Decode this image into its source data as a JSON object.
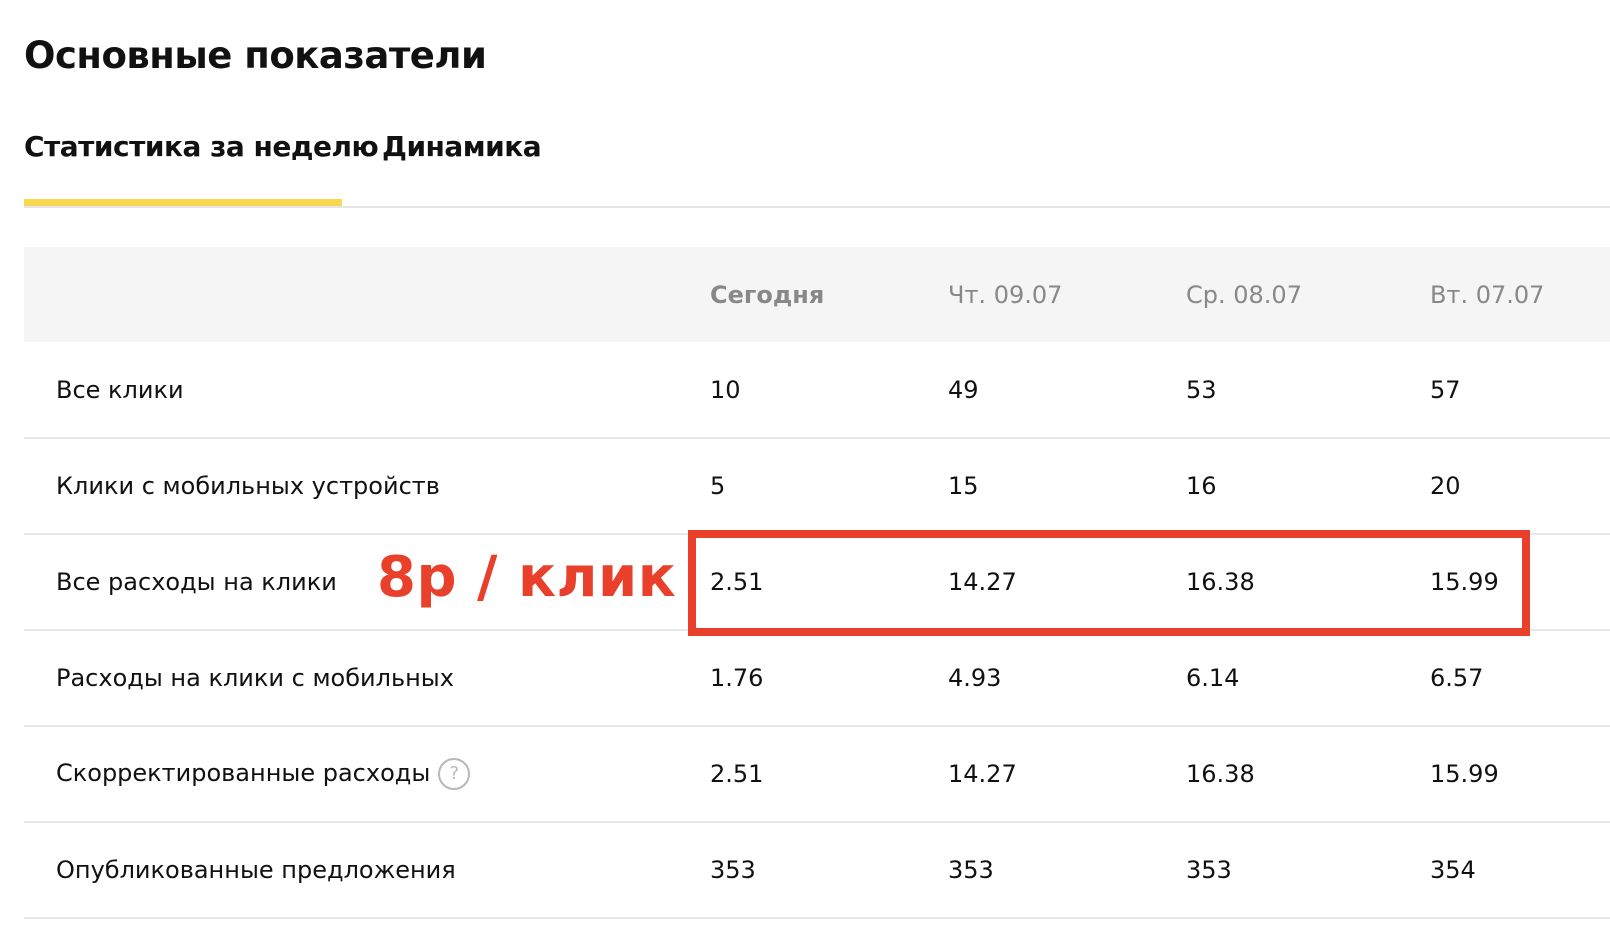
{
  "page": {
    "title": "Основные показатели"
  },
  "tabs": [
    {
      "label": "Статистика за неделю",
      "active": true
    },
    {
      "label": "Динамика",
      "active": false
    }
  ],
  "colors": {
    "tab_accent": "#f7d84f",
    "annotation": "#e8402a",
    "header_bg": "#f5f5f5"
  },
  "table": {
    "columns": [
      "",
      "Сегодня",
      "Чт. 09.07",
      "Ср. 08.07",
      "Вт. 07.07"
    ],
    "rows": [
      {
        "label": "Все клики",
        "values": [
          "10",
          "49",
          "53",
          "57"
        ]
      },
      {
        "label": "Клики с мобильных устройств",
        "values": [
          "5",
          "15",
          "16",
          "20"
        ]
      },
      {
        "label": "Все расходы на клики",
        "values": [
          "2.51",
          "14.27",
          "16.38",
          "15.99"
        ]
      },
      {
        "label": "Расходы на клики с мобильных",
        "values": [
          "1.76",
          "4.93",
          "6.14",
          "6.57"
        ]
      },
      {
        "label": "Скорректированные расходы",
        "values": [
          "2.51",
          "14.27",
          "16.38",
          "15.99"
        ],
        "help_icon": "?"
      },
      {
        "label": "Опубликованные предложения",
        "values": [
          "353",
          "353",
          "353",
          "354"
        ]
      }
    ]
  },
  "annotation": {
    "text": "8р / клик"
  }
}
